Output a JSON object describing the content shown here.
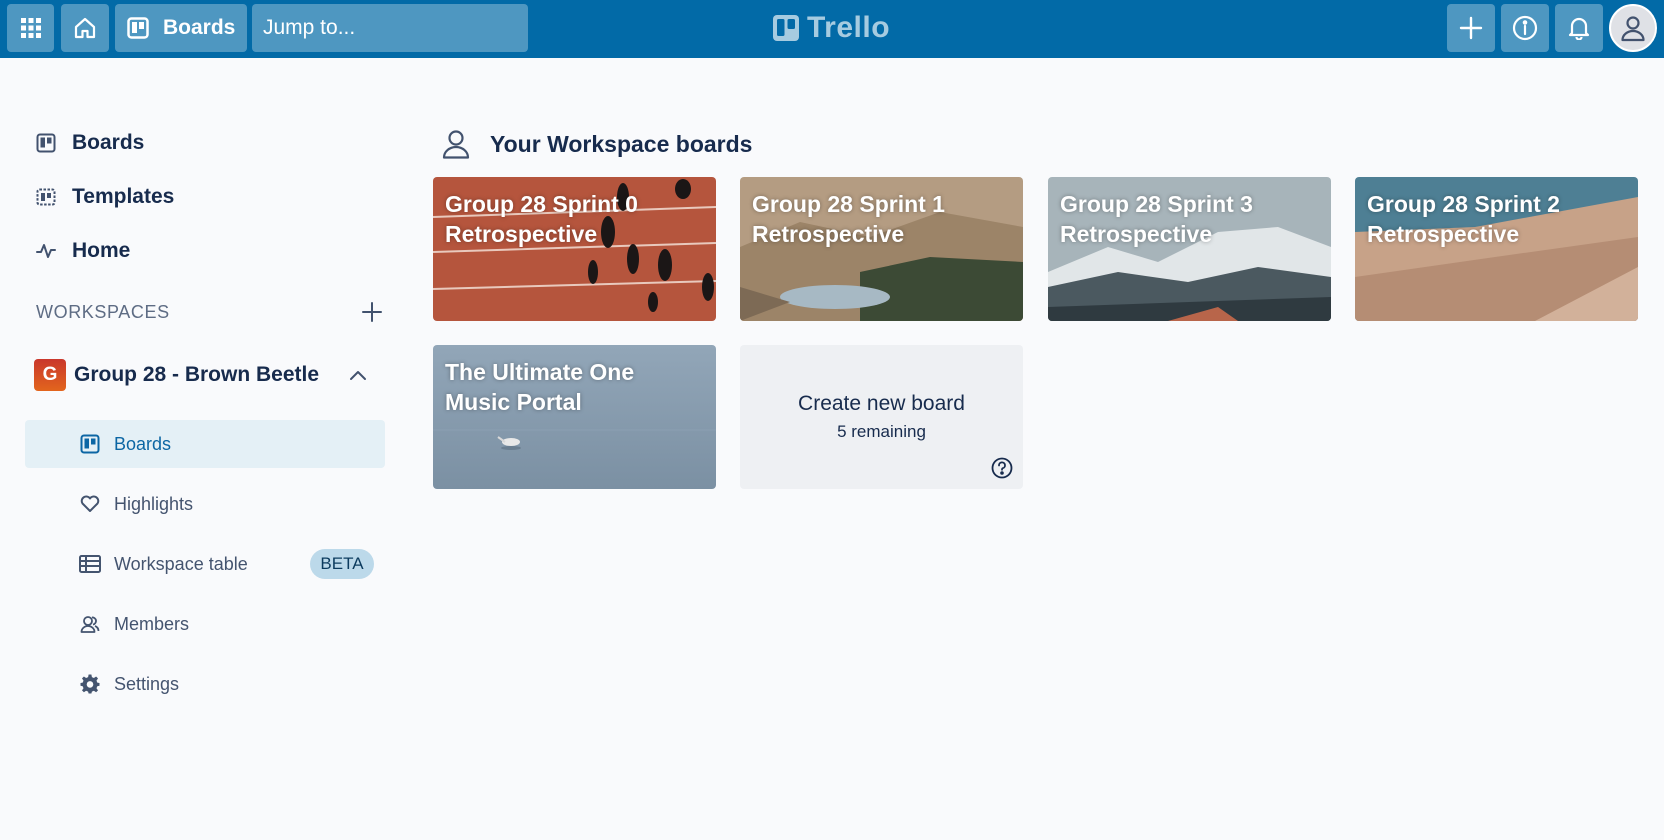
{
  "topbar": {
    "boards_label": "Boards",
    "search_placeholder": "Jump to...",
    "logo_text": "Trello",
    "color": "#026aa7"
  },
  "sidebar": {
    "nav": [
      {
        "label": "Boards",
        "icon": "board-icon"
      },
      {
        "label": "Templates",
        "icon": "template-icon"
      },
      {
        "label": "Home",
        "icon": "activity-icon"
      }
    ],
    "workspaces_label": "WORKSPACES",
    "workspace": {
      "initial": "G",
      "name": "Group 28 - Brown Beetle",
      "items": [
        {
          "label": "Boards",
          "icon": "board-icon",
          "active": true
        },
        {
          "label": "Highlights",
          "icon": "heart-icon"
        },
        {
          "label": "Workspace table",
          "icon": "table-icon",
          "badge": "BETA"
        },
        {
          "label": "Members",
          "icon": "members-icon"
        },
        {
          "label": "Settings",
          "icon": "gear-icon"
        }
      ]
    }
  },
  "main": {
    "section_title": "Your Workspace boards",
    "boards": [
      {
        "title": "Group 28 Sprint 0 Retrospective",
        "background": "running-track"
      },
      {
        "title": "Group 28 Sprint 1 Retrospective",
        "background": "mountain-lake"
      },
      {
        "title": "Group 28 Sprint 3 Retrospective",
        "background": "snowy-mountains"
      },
      {
        "title": "Group 28 Sprint 2 Retrospective",
        "background": "desert-dunes"
      },
      {
        "title": "The Ultimate One Music Portal",
        "background": "misty-lake-pelican"
      }
    ],
    "create": {
      "label": "Create new board",
      "remaining": "5 remaining"
    }
  }
}
